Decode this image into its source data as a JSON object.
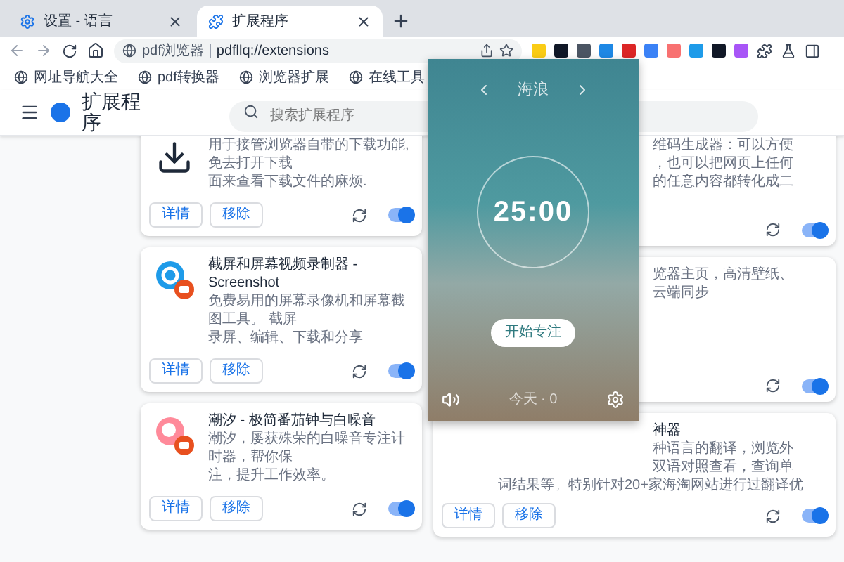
{
  "tabs": [
    {
      "label": "设置 - 语言",
      "selected": false
    },
    {
      "label": "扩展程序",
      "selected": true
    }
  ],
  "address_bar": {
    "site_label": "pdf浏览器",
    "url": "pdfllq://extensions"
  },
  "bookmarks": [
    "网址导航大全",
    "pdf转换器",
    "浏览器扩展",
    "在线工具"
  ],
  "header": {
    "title": "扩展程序",
    "search": {
      "placeholder": "搜索扩展程序"
    }
  },
  "left_cards": [
    {
      "lines": [
        "用于接管浏览器自带的下载功能,免去打开下载",
        "面来查看下载文件的麻烦."
      ],
      "buttons": [
        "详情",
        "移除"
      ],
      "on": true
    },
    {
      "title": "截屏和屏幕视频录制器 - Screenshot",
      "lines": [
        "免费易用的屏幕录像机和屏幕截图工具。 截屏",
        "录屏、编辑、下载和分享"
      ],
      "buttons": [
        "详情",
        "移除"
      ],
      "on": true
    },
    {
      "title": "潮汐 - 极简番茄钟与白噪音",
      "lines": [
        "潮汐，屡获殊荣的白噪音专注计时器，帮你保",
        "注，提升工作效率。"
      ],
      "buttons": [
        "详情",
        "移除"
      ],
      "on": true
    }
  ],
  "right_cards": [
    {
      "lines": [
        "维码生成器：可以方便",
        "，也可以把网页上任何",
        "的任意内容都转化成二"
      ],
      "on": true
    },
    {
      "lines": [
        "览器主页，高清壁纸、",
        "云端同步"
      ],
      "on": true
    },
    {
      "title": "神器",
      "lines": [
        "种语言的翻译，浏览外",
        "双语对照查看，查询单",
        "词结果等。特别针对20+家海淘网站进行过翻译优"
      ],
      "buttons": [
        "详情",
        "移除"
      ],
      "on": true
    }
  ],
  "popup": {
    "sound_name": "海浪",
    "timer": "25:00",
    "start_button": "开始专注",
    "today": "今天 · 0"
  }
}
